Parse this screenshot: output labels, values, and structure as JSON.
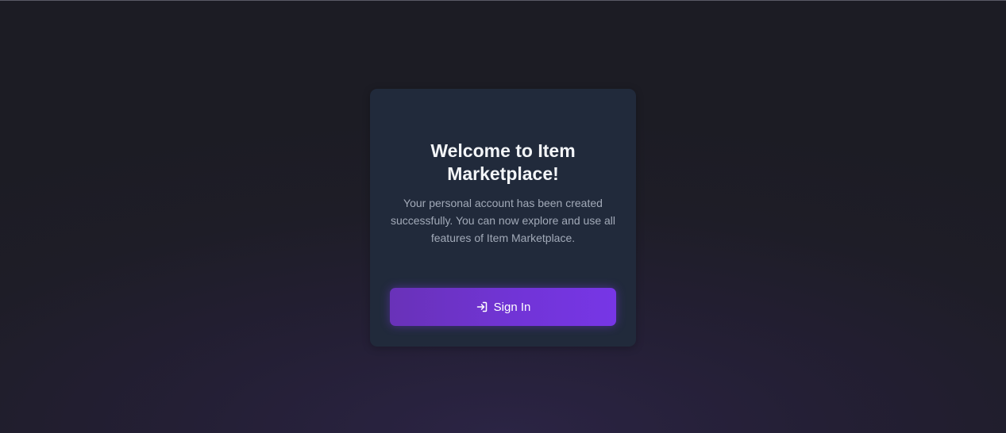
{
  "card": {
    "title": "Welcome to Item Marketplace!",
    "description": "Your personal account has been created successfully. You can now explore and use all features of Item Marketplace.",
    "button": {
      "label": "Sign In",
      "icon": "sign-in-icon"
    }
  },
  "colors": {
    "accent": "#7c3aed",
    "card_background": "#212a3b",
    "page_background": "#1c1c24"
  }
}
